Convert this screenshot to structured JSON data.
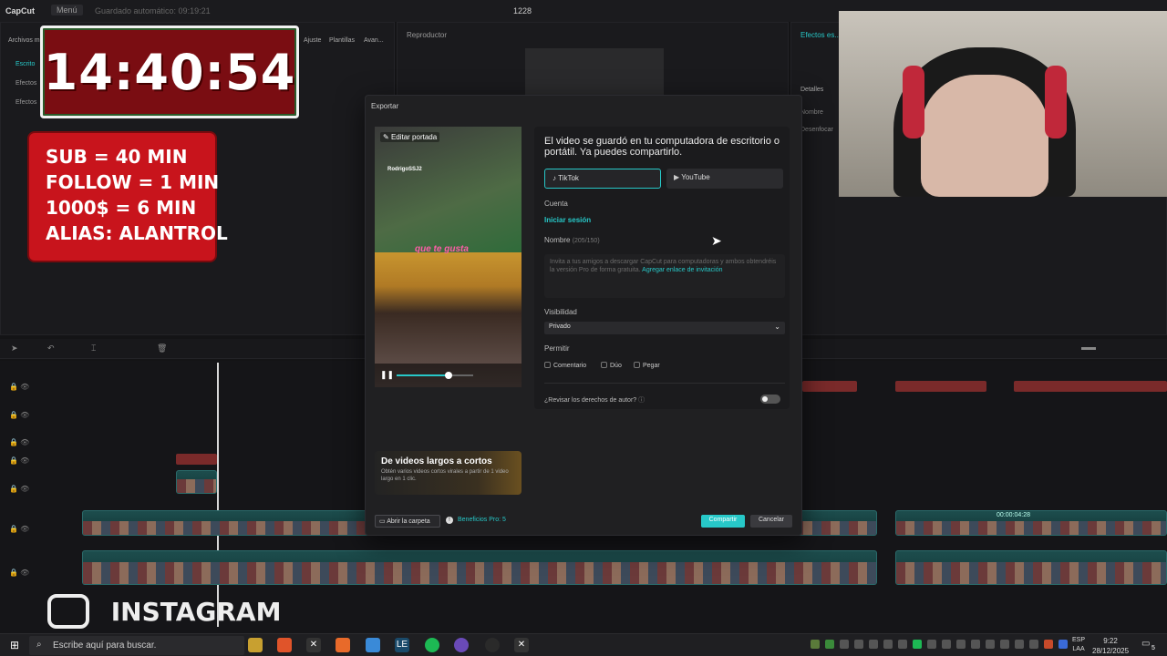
{
  "app": {
    "logo": "CapCut",
    "menu": "Menú",
    "autosave": "Guardado automático: 09:19:21",
    "project_name": "1228",
    "player_label": "Reproductor",
    "left_tabs": [
      "Archivos m...",
      "Ajuste",
      "Plantillas",
      "Avan..."
    ],
    "left_items": [
      "Escrito",
      "Efectos",
      "Efectos"
    ],
    "right_panel": [
      "Efectos es...",
      "Detalles",
      "Nombre",
      "Desenfocar"
    ],
    "timeline_time": "00:00:04:28"
  },
  "overlay": {
    "timer": "14:40:54",
    "rules": [
      "SUB = 40 MIN",
      "FOLLOW = 1 MIN",
      "1000$ = 6 MIN",
      "ALIAS: ALANTROL"
    ],
    "social": "INSTAGRAM"
  },
  "dialog": {
    "title": "Exportar",
    "edit_cover": "Editar portada",
    "video_caption": "que te gusta",
    "video_handle": "RodrigoSSJ2",
    "progress": 0.68,
    "promo_title": "De videos largos a cortos",
    "promo_sub": "Obtén varios videos cortos virales a partir de 1 video largo en 1 clic.",
    "message": "El video se guardó en tu computadora de escritorio o portátil. Ya puedes compartirlo.",
    "platforms": [
      {
        "label": "TikTok",
        "icon": "tiktok-icon"
      },
      {
        "label": "YouTube",
        "icon": "youtube-icon"
      }
    ],
    "account_label": "Cuenta",
    "login": "Iniciar sesión",
    "name_label": "Nombre",
    "name_count": "(205/150)",
    "description": "Invita a tus amigos a descargar CapCut para computadoras y ambos obtendréis la versión Pro de forma gratuita.",
    "description_link": "Agregar enlace de invitación",
    "visibility_label": "Visibilidad",
    "visibility_value": "Privado",
    "allow_label": "Permitir",
    "allow_options": [
      "Comentario",
      "Dúo",
      "Pegar"
    ],
    "copyright": "¿Revisar los derechos de autor?",
    "open_folder": "Abrir la carpeta",
    "pro_benefits": "Beneficios Pro: 5",
    "share": "Compartir",
    "cancel": "Cancelar"
  },
  "taskbar": {
    "search_placeholder": "Escribe aquí para buscar.",
    "lang": "ESP",
    "lang2": "LAA",
    "time": "9:22",
    "date": "28/12/2025",
    "notifications": "5"
  },
  "colors": {
    "accent": "#27c8c8",
    "timer_bg": "#7a0d12",
    "rules_bg": "#c8141c"
  }
}
